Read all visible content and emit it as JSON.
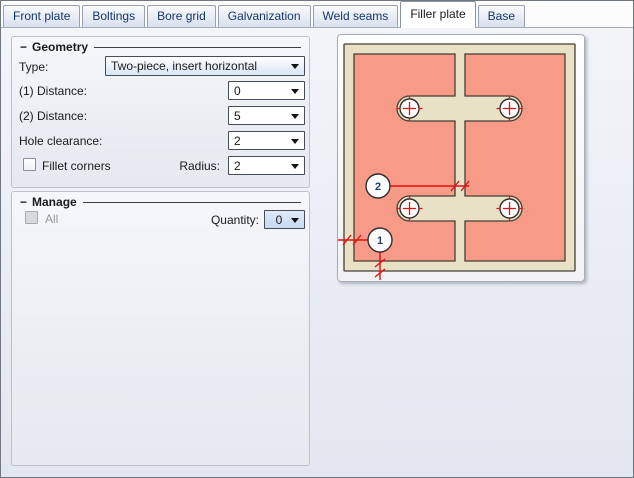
{
  "tabbar": {
    "tabs": [
      {
        "label": "Front plate",
        "active": false
      },
      {
        "label": "Boltings",
        "active": false
      },
      {
        "label": "Bore grid",
        "active": false
      },
      {
        "label": "Galvanization",
        "active": false
      },
      {
        "label": "Weld seams",
        "active": false
      },
      {
        "label": "Filler plate",
        "active": true
      },
      {
        "label": "Base",
        "active": false
      }
    ]
  },
  "geometry_group": {
    "collapse_glyph": "−",
    "title": "Geometry",
    "type_label": "Type:",
    "type_value": "Two-piece, insert horizontal",
    "distance1_label": "(1) Distance:",
    "distance1_value": "0",
    "distance2_label": "(2) Distance:",
    "distance2_value": "5",
    "hole_clearance_label": "Hole clearance:",
    "hole_clearance_value": "2",
    "fillet_corners_label": "Fillet corners",
    "fillet_corners_checked": false,
    "radius_label": "Radius:",
    "radius_value": "2"
  },
  "manage_group": {
    "collapse_glyph": "−",
    "title": "Manage",
    "all_label": "All",
    "all_checked": false,
    "all_enabled": false,
    "quantity_label": "Quantity:",
    "quantity_value": "0"
  },
  "diagram": {
    "marker_1_label": "1",
    "marker_2_label": "2"
  },
  "colors": {
    "accent_tab_text": "#17366B",
    "plate_fill": "#E8E1C6",
    "plate_stroke": "#423F33",
    "filler_fill": "#F79B88",
    "hole_fill": "#FFFFFF",
    "dimension_red": "#E80F0F",
    "marker_text": "#1C3E73",
    "combo_focus_tint": "#D8E6F6",
    "quantity_combo_fill": "#C6DAF0",
    "disabled_text": "#9A9A9A"
  }
}
